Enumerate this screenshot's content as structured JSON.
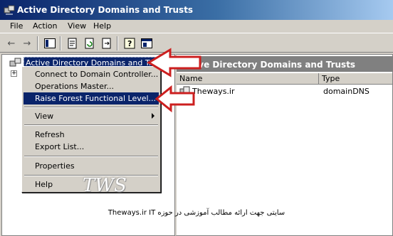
{
  "window": {
    "title": "Active Directory Domains and Trusts",
    "icon": "ad-domains-icon"
  },
  "menu": [
    "File",
    "Action",
    "View",
    "Help"
  ],
  "toolbar": [
    "back-icon",
    "forward-icon",
    "show-hide-tree-icon",
    "properties-icon",
    "refresh-icon",
    "export-icon",
    "help-icon",
    "console-icon"
  ],
  "tree": {
    "root_label": "Active Directory Domains and Trusts"
  },
  "right_pane": {
    "header": "Active Directory Domains and Trusts",
    "columns": [
      "Name",
      "Type"
    ],
    "rows": [
      {
        "name": "Theways.ir",
        "type": "domainDNS"
      }
    ]
  },
  "context_menu": {
    "items": [
      "Connect to Domain Controller...",
      "Operations Master...",
      "Raise Forest Functional Level...",
      "View",
      "Refresh",
      "Export List...",
      "Properties",
      "Help"
    ],
    "selected": "Raise Forest Functional Level..."
  },
  "watermark": {
    "text": "TWS",
    "tagline": "Theways.ir"
  },
  "footer": {
    "text": "سایتی جهت ارائه مطالب آموزشی در حوزه IT"
  },
  "colors": {
    "arrow": "#cc1f1f",
    "selection": "#0a246a",
    "header": "#808080"
  }
}
